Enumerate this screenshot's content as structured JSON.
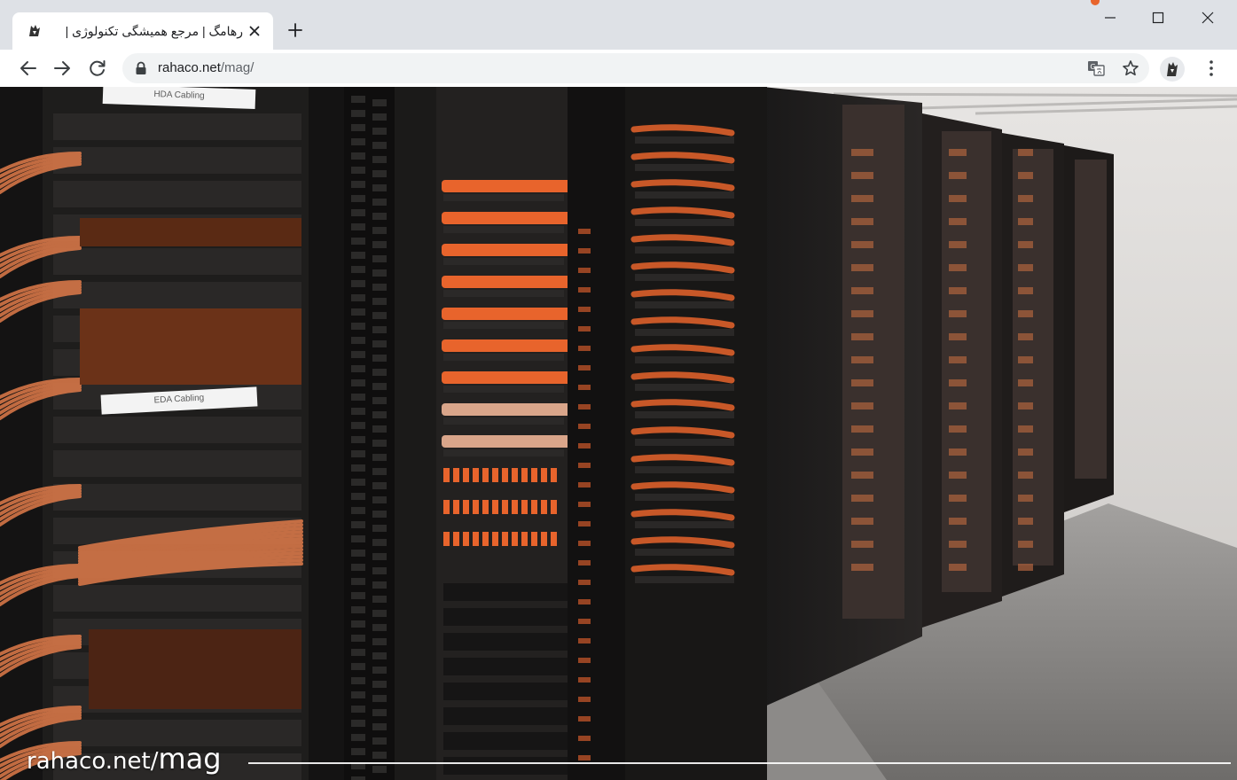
{
  "browser": {
    "tab": {
      "title": "رهامگ | مرجع همیشگی تکنولوژی |",
      "favicon": "rahaco-logo-icon"
    },
    "address_bar": {
      "host": "rahaco.net",
      "path": "/mag/"
    },
    "icons": {
      "back": "arrow-left-icon",
      "forward": "arrow-right-icon",
      "reload": "reload-icon",
      "lock": "lock-icon",
      "translate": "translate-icon",
      "bookmark": "star-icon",
      "extension": "rahaco-logo-icon",
      "menu": "kebab-menu-icon"
    },
    "window_controls": [
      "minimize",
      "maximize",
      "close"
    ]
  },
  "page": {
    "hero": {
      "rack_labels": {
        "top": "HDA Cabling",
        "middle": "EDA Cabling"
      },
      "watermark_host": "rahaco.net/",
      "watermark_path": "mag"
    }
  },
  "colors": {
    "tabstrip": "#dee1e6",
    "omnibox": "#f1f3f4",
    "cable_orange": "#e8642c",
    "rack_black": "#1c1b1b",
    "floor_grey": "#8a8a88",
    "wall_light": "#d9d7d5"
  }
}
